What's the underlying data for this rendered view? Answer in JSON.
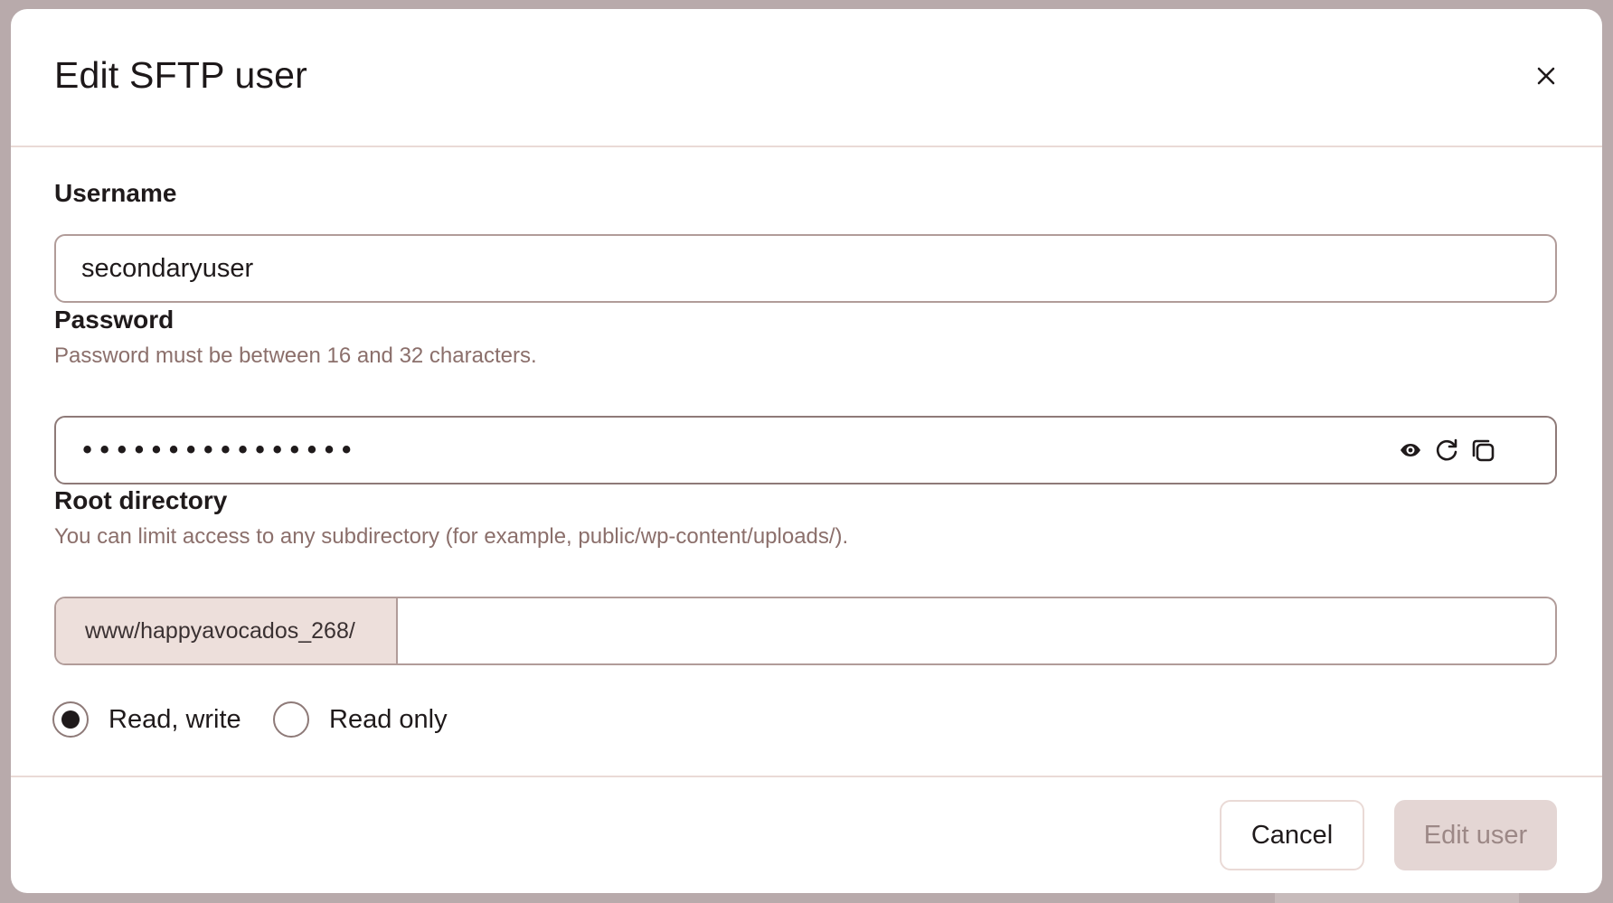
{
  "dialog": {
    "title": "Edit SFTP user",
    "close_label": "Close"
  },
  "username": {
    "label": "Username",
    "value": "secondaryuser"
  },
  "password": {
    "label": "Password",
    "hint": "Password must be between 16 and 32 characters.",
    "masked_value": "••••••••••••••••",
    "icons": [
      "eye-icon",
      "refresh-icon",
      "copy-icon"
    ]
  },
  "root_directory": {
    "label": "Root directory",
    "hint": "You can limit access to any subdirectory (for example, public/wp-content/uploads/).",
    "prefix": "www/happyavocados_268/",
    "value": ""
  },
  "permissions": {
    "options": [
      {
        "label": "Read, write",
        "checked": true
      },
      {
        "label": "Read only",
        "checked": false
      }
    ]
  },
  "footer": {
    "cancel_label": "Cancel",
    "submit_label": "Edit user"
  },
  "colors": {
    "backdrop": "#b8aaab",
    "border": "#b19c99",
    "prefix_bg": "#eddfdb",
    "hint_text": "#8b6f6b",
    "disabled_button_bg": "#e4d6d4",
    "disabled_button_text": "#9c8886"
  }
}
